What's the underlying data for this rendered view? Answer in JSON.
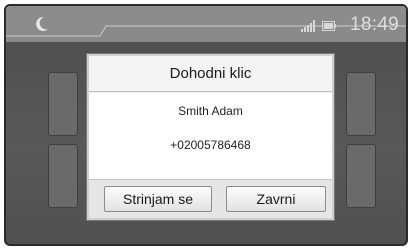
{
  "status_bar": {
    "time": "18:49",
    "icons": [
      "moon-icon",
      "signal-icon",
      "battery-icon"
    ]
  },
  "dialog": {
    "title": "Dohodni klic",
    "caller_name": "Smith Adam",
    "caller_number": "+02005786468",
    "buttons": {
      "accept_label": "Strinjam se",
      "decline_label": "Zavrni"
    }
  },
  "colors": {
    "background": "#585858",
    "dialog": "#f2f2f2",
    "status_bar": "#8a8a8a"
  }
}
